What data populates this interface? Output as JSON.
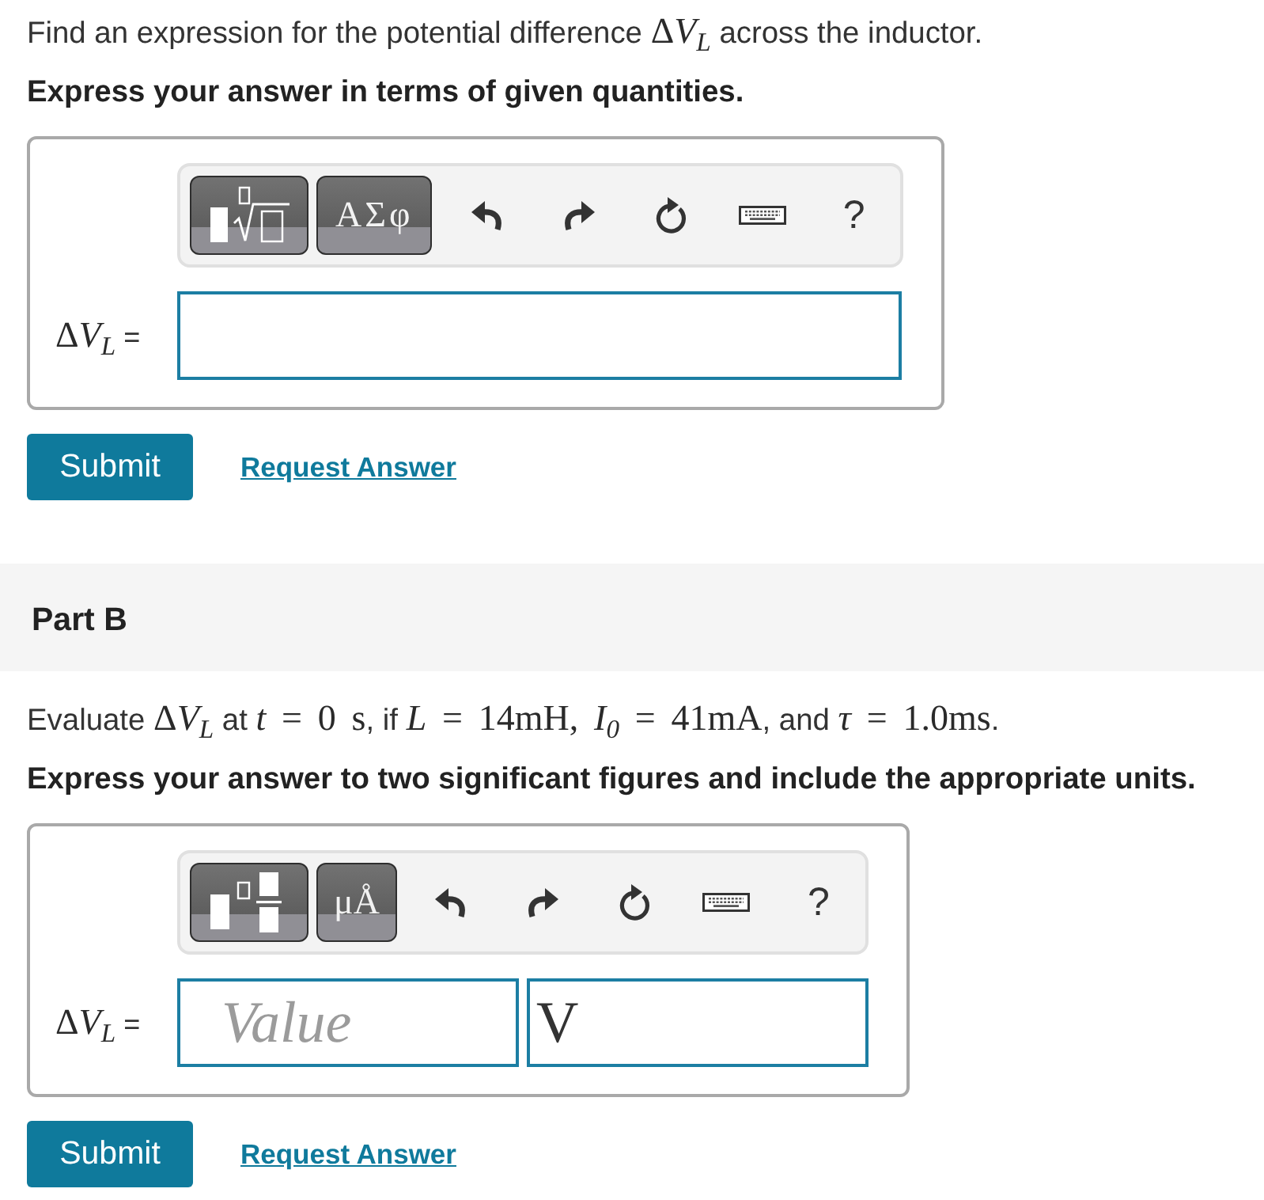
{
  "parts": [
    {
      "prompt": [
        {
          "kind": "text",
          "text": "Find an expression for the potential difference "
        },
        {
          "kind": "math",
          "text": "Δ"
        },
        {
          "kind": "math",
          "text": "*V*$_{L}$"
        },
        {
          "kind": "text",
          "text": " across the inductor."
        }
      ],
      "instruction": "Express your answer in terms of given quantities.",
      "answer": {
        "toolbar": [
          {
            "kind": "radical"
          },
          {
            "kind": "symbols",
            "label": "ΑΣφ"
          },
          {
            "kind": "undo"
          },
          {
            "kind": "redo"
          },
          {
            "kind": "reset"
          },
          {
            "kind": "keyboard"
          },
          {
            "kind": "help",
            "label": "?"
          }
        ],
        "label": [
          {
            "kind": "math",
            "text": "Δ"
          },
          {
            "kind": "math",
            "text": "*V*$_{L}$"
          },
          {
            "kind": "text",
            "text": " ="
          }
        ],
        "fields": [
          {
            "kind": "expression"
          }
        ]
      },
      "submit": "Submit",
      "request_answer": "Request Answer"
    },
    {
      "title": "Part B",
      "prompt": [
        {
          "kind": "text",
          "text": "Evaluate "
        },
        {
          "kind": "math",
          "text": "Δ"
        },
        {
          "kind": "math",
          "text": "*V*$_{L}$"
        },
        {
          "kind": "text",
          "text": " at "
        },
        {
          "kind": "math",
          "text": "*t* = 0 s"
        },
        {
          "kind": "text",
          "text": ", if "
        },
        {
          "kind": "math",
          "text": "*L* = 14mH, *I*$_{0}$ = 41mA"
        },
        {
          "kind": "text",
          "text": ", and "
        },
        {
          "kind": "math",
          "text": "*τ* = 1.0ms"
        },
        {
          "kind": "text",
          "text": "."
        }
      ],
      "instruction": "Express your answer to two significant figures and include the appropriate units.",
      "answer": {
        "toolbar": [
          {
            "kind": "fraction"
          },
          {
            "kind": "units",
            "label": "μÅ"
          },
          {
            "kind": "undo"
          },
          {
            "kind": "redo"
          },
          {
            "kind": "reset"
          },
          {
            "kind": "keyboard"
          },
          {
            "kind": "help",
            "label": "?"
          }
        ],
        "label": [
          {
            "kind": "math",
            "text": "Δ"
          },
          {
            "kind": "math",
            "text": "*V*$_{L}$"
          },
          {
            "kind": "text",
            "text": " ="
          }
        ],
        "fields": [
          {
            "kind": "value",
            "placeholder": "Value"
          },
          {
            "kind": "units",
            "value": "V"
          }
        ]
      },
      "submit": "Submit",
      "request_answer": "Request Answer"
    }
  ]
}
